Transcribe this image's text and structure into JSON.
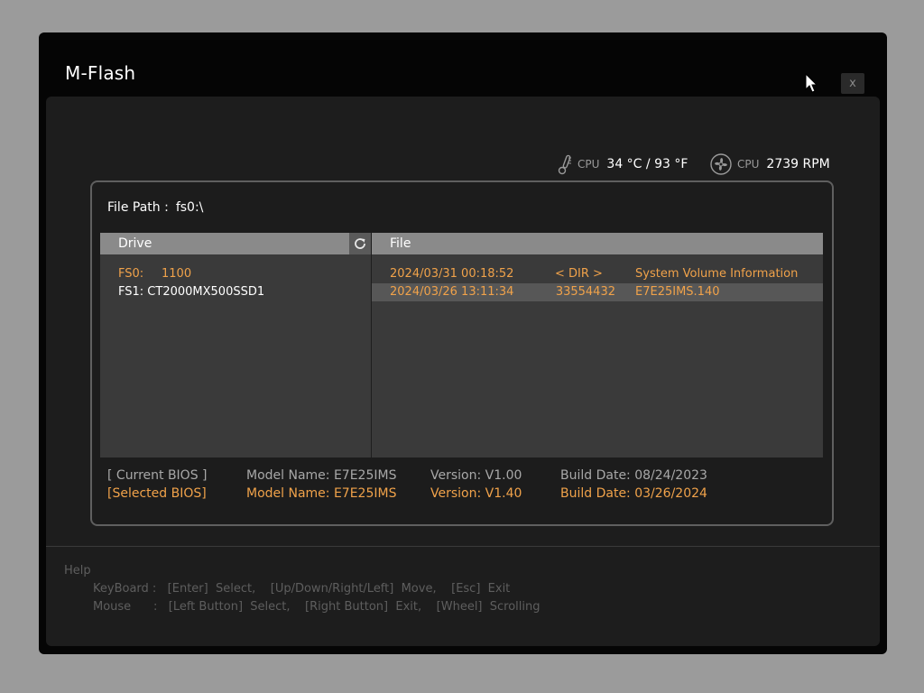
{
  "window": {
    "title": "M-Flash",
    "close_label": "x"
  },
  "monitor": {
    "cpu_temp": {
      "label": "CPU",
      "value": "34 °C / 93 °F"
    },
    "cpu_fan": {
      "label": "CPU",
      "value": "2739 RPM"
    }
  },
  "file_path": {
    "label": "File Path :",
    "value": "fs0:\\"
  },
  "drive_panel": {
    "header": "Drive",
    "items": [
      {
        "key": "FS0:",
        "value": "1100",
        "selected": true
      },
      {
        "key": "FS1:",
        "value": "CT2000MX500SSD1",
        "selected": false
      }
    ]
  },
  "file_panel": {
    "header": "File",
    "rows": [
      {
        "date": "2024/03/31 00:18:52",
        "size": "< DIR >",
        "name": "System Volume Information"
      },
      {
        "date": "2024/03/26 13:11:34",
        "size": "33554432",
        "name": "E7E25IMS.140"
      }
    ]
  },
  "bios": {
    "current": {
      "label": "[ Current BIOS  ]",
      "model": "Model Name: E7E25IMS",
      "version": "Version: V1.00",
      "build": "Build Date: 08/24/2023"
    },
    "selected": {
      "label": "[Selected BIOS]",
      "model": "Model Name: E7E25IMS",
      "version": "Version: V1.40",
      "build": "Build Date: 03/26/2024"
    }
  },
  "help": {
    "title": "Help",
    "keyboard": "KeyBoard :   [Enter]  Select,    [Up/Down/Right/Left]  Move,    [Esc]  Exit",
    "mouse": "Mouse      :   [Left Button]  Select,    [Right Button]  Exit,    [Wheel]  Scrolling"
  },
  "colors": {
    "accent": "#f0a24a",
    "header": "#8a8a8a",
    "list_bg": "#3a3a3a"
  },
  "icons": [
    "thermometer-icon",
    "fan-icon",
    "refresh-icon",
    "mouse-cursor-icon"
  ]
}
